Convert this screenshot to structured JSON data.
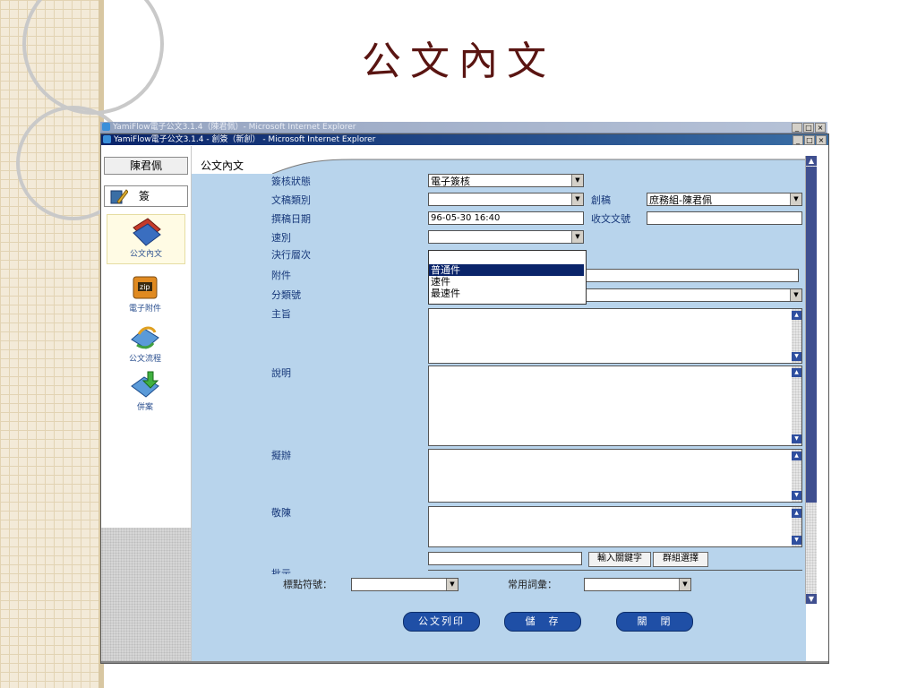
{
  "slide": {
    "title": "公文內文"
  },
  "windows": {
    "back_title": "YamiFlow電子公文3.1.4（陳君佩）- Microsoft Internet Explorer",
    "front_title": "YamiFlow電子公文3.1.4 - 創簽（新創） - Microsoft Internet Explorer",
    "btn_min": "_",
    "btn_max": "□",
    "btn_close": "×"
  },
  "sidebar": {
    "user": "陳君佩",
    "sign": "簽",
    "items": [
      {
        "label": "公文內文",
        "icon": "document-stack-icon",
        "active": true
      },
      {
        "label": "電子附件",
        "icon": "zip-folder-icon",
        "active": false
      },
      {
        "label": "公文流程",
        "icon": "workflow-icon",
        "active": false
      },
      {
        "label": "併案",
        "icon": "merge-arrow-icon",
        "active": false
      }
    ]
  },
  "tab": {
    "label": "公文內文"
  },
  "form": {
    "sign_status": {
      "label": "簽核狀態",
      "value": "電子簽核"
    },
    "doc_type": {
      "label": "文稿類別",
      "value": ""
    },
    "drafter": {
      "label": "創稿",
      "value": "庶務組-陳君佩"
    },
    "draft_date": {
      "label": "撰稿日期",
      "value": "96-05-30  16:40"
    },
    "recv_no": {
      "label": "收文文號",
      "value": ""
    },
    "speed": {
      "label": "速別",
      "value": ""
    },
    "decision_level": {
      "label": "決行層次"
    },
    "attachment": {
      "label": "附件",
      "value": ""
    },
    "category_no": {
      "label": "分類號"
    },
    "subject": {
      "label": "主旨"
    },
    "description": {
      "label": "說明"
    },
    "proposal": {
      "label": "擬辦"
    },
    "respectfully": {
      "label": "敬陳"
    },
    "partial_label": "批示",
    "keyword_btn": "輸入關鍵字",
    "group_btn": "群組選擇",
    "punctuation": {
      "label": "標點符號：",
      "value": ""
    },
    "common_words": {
      "label": "常用詞彙：",
      "value": ""
    }
  },
  "speed_dropdown": {
    "options": [
      "普通件",
      "速件",
      "最速件"
    ],
    "highlighted": 0
  },
  "actions": {
    "print": "公文列印",
    "save": "儲　存",
    "close": "關　閉"
  },
  "colors": {
    "panel": "#b8d4ec",
    "title": "#5a1512",
    "label": "#17387a",
    "button": "#1f4fa6"
  }
}
